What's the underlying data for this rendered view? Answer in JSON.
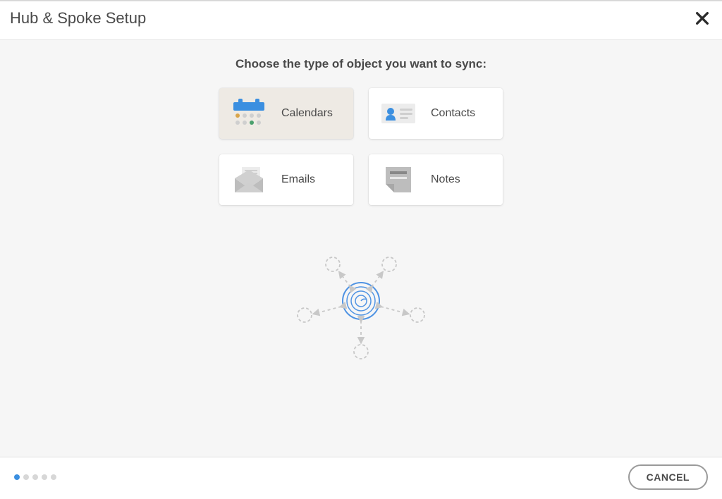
{
  "header": {
    "title": "Hub & Spoke Setup"
  },
  "main": {
    "prompt": "Choose the type of object you want to sync:",
    "options": {
      "calendars": {
        "label": "Calendars",
        "selected": true
      },
      "contacts": {
        "label": "Contacts",
        "selected": false
      },
      "emails": {
        "label": "Emails",
        "selected": false
      },
      "notes": {
        "label": "Notes",
        "selected": false
      }
    }
  },
  "footer": {
    "cancel_label": "CANCEL",
    "step_count": 5,
    "step_active": 1
  }
}
